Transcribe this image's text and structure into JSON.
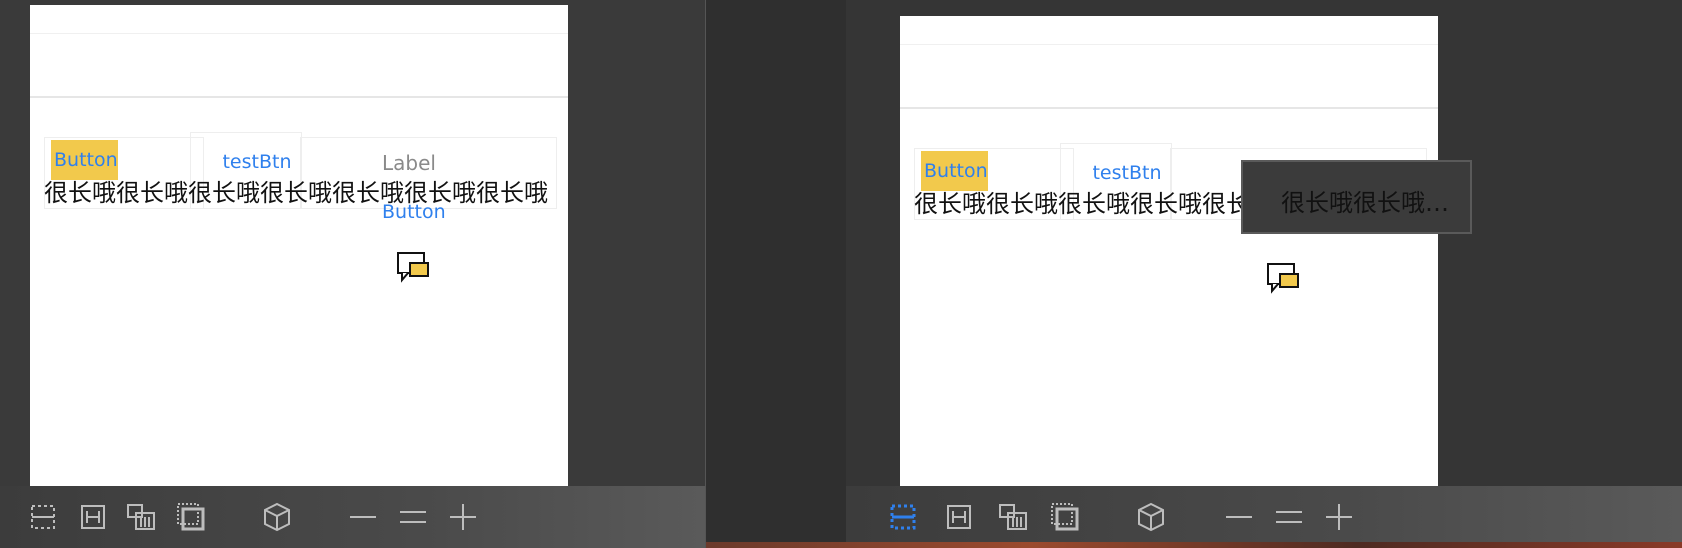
{
  "canvas": {
    "yellow_button_label": "Button",
    "test_button_label": "testBtn",
    "label_text": "Label",
    "blue_button_label": "Button",
    "long_text_full": "很长哦很长哦很长哦很长哦很长哦很长哦很长哦",
    "long_text_truncated_tail": "很长哦很长哦…"
  },
  "toolbar": {
    "icons": [
      "align-top-bottom-icon",
      "align-left-right-icon",
      "stack-grid-icon",
      "layers-icon",
      "cube-icon",
      "minus-icon",
      "equals-icon",
      "plus-icon"
    ],
    "active_icon_right": "align-top-bottom-icon",
    "active_color": "#2f80ed",
    "icon_color": "#bdbdbd"
  },
  "colors": {
    "button_yellow": "#f2c94c",
    "link_blue": "#2f80ed",
    "canvas_bg": "#ffffff"
  }
}
